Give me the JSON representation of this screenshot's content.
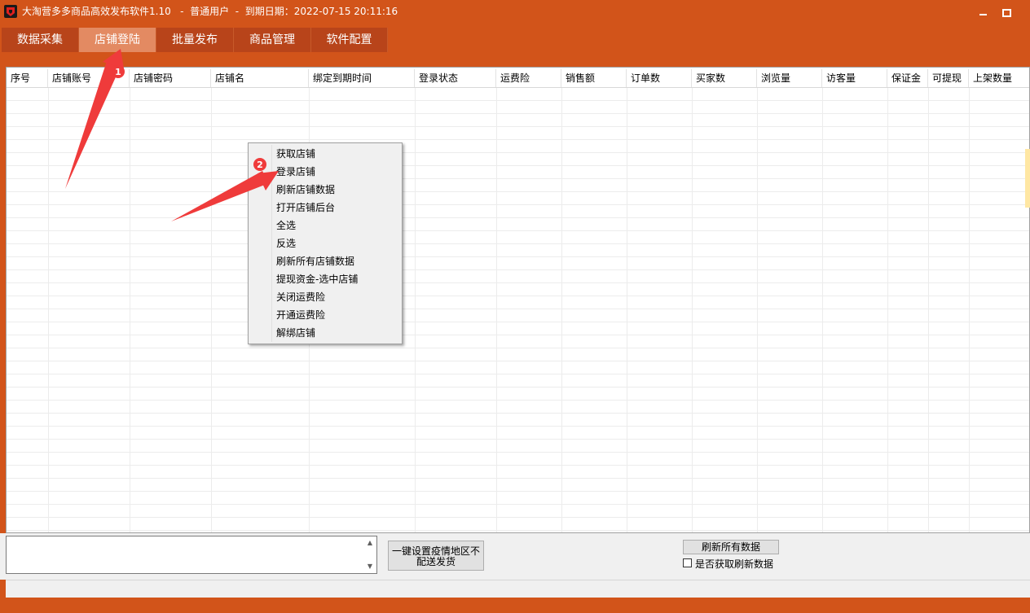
{
  "window": {
    "title": "大淘营多多商品高效发布软件1.10   -  普通用户  -  到期日期：2022-07-15 20:11:16",
    "icon": "app-logo-icon",
    "controls": [
      "minimize-icon",
      "maximize-icon",
      "close-icon"
    ]
  },
  "tabs": [
    {
      "label": "数据采集"
    },
    {
      "label": "店铺登陆",
      "active": true
    },
    {
      "label": "批量发布"
    },
    {
      "label": "商品管理"
    },
    {
      "label": "软件配置"
    }
  ],
  "grid": {
    "columns": [
      "序号",
      "店铺账号",
      "店铺密码",
      "店铺名",
      "绑定到期时间",
      "登录状态",
      "运费险",
      "销售额",
      "订单数",
      "买家数",
      "浏览量",
      "访客量",
      "保证金",
      "可提现",
      "上架数量"
    ],
    "rows": []
  },
  "context_menu": {
    "items": [
      "获取店铺",
      "登录店铺",
      "刷新店铺数据",
      "打开店铺后台",
      "全选",
      "反选",
      "刷新所有店铺数据",
      "提现资金-选中店铺",
      "关闭运费险",
      "开通运费险",
      "解绑店铺"
    ]
  },
  "annotations": {
    "badge_1": "1",
    "badge_2": "2",
    "color": "#ef3b3b"
  },
  "bottom": {
    "log_text": "",
    "set_area_button_line1": "一键设置疫情地区不",
    "set_area_button_line2": "配送发货",
    "refresh_all_button": "刷新所有数据",
    "checkbox_label": "是否获取刷新数据",
    "checkbox_checked": false
  },
  "colors": {
    "frame": "#d2541a",
    "tab": "#b8441a",
    "tab_active": "#e38a62"
  }
}
